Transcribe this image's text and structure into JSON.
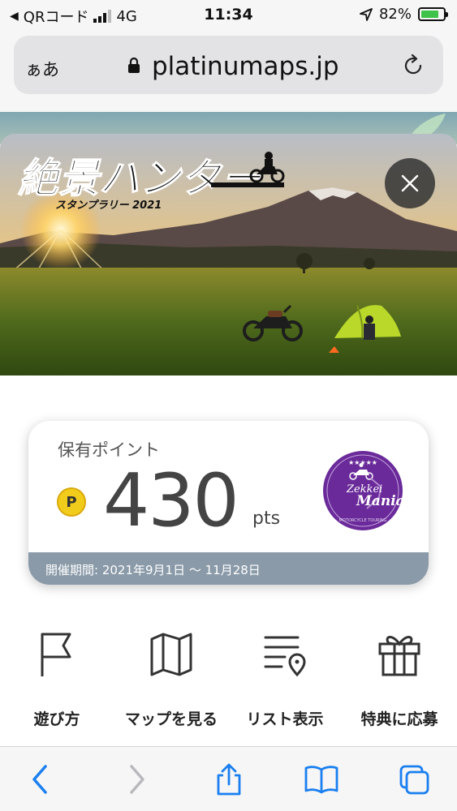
{
  "status_bar": {
    "back_app": "QRコード",
    "network": "4G",
    "time": "11:34",
    "battery": "82%",
    "battery_level": 0.82
  },
  "browser": {
    "text_size_button": "ぁあ",
    "url": "platinumaps.jp"
  },
  "hero": {
    "logo_title": "絶景ハンター",
    "logo_subtitle": "スタンプラリー 2021"
  },
  "points_card": {
    "label": "保有ポイント",
    "coin_symbol": "P",
    "points": "430",
    "unit": "pts",
    "badge_line1": "Zekkei",
    "badge_line2": "Mania",
    "badge_footer": "MOTORCYCLE TOURING",
    "period": "開催期間: 2021年9月1日 〜 11月28日"
  },
  "menu": {
    "items": [
      {
        "label": "遊び方",
        "icon": "flag-icon"
      },
      {
        "label": "マップを見る",
        "icon": "map-icon"
      },
      {
        "label": "リスト表示",
        "icon": "list-pin-icon"
      },
      {
        "label": "特典に応募",
        "icon": "gift-icon"
      }
    ]
  },
  "colors": {
    "accent_blue": "#1a7ff0",
    "badge_purple": "#6a2a9a",
    "period_bar": "#8a9aa8",
    "coin": "#f2cc1a"
  }
}
